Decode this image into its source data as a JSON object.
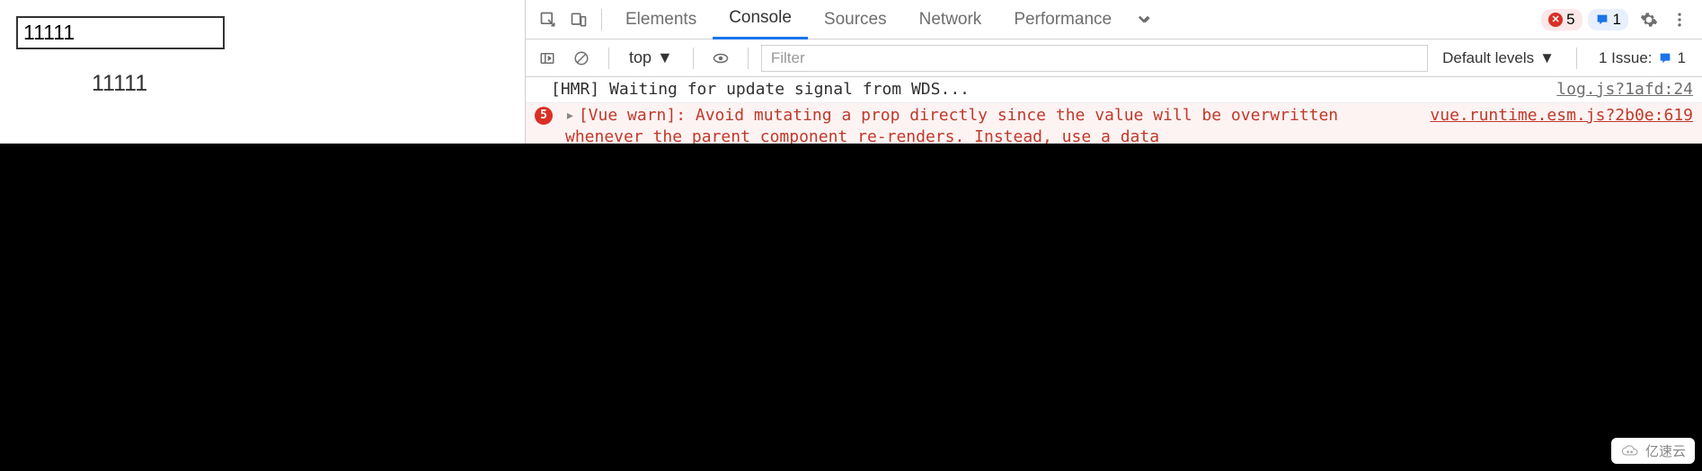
{
  "page": {
    "input_value": "11111",
    "display_value": "11111"
  },
  "devtools": {
    "tabs": {
      "elements": "Elements",
      "console": "Console",
      "sources": "Sources",
      "network": "Network",
      "performance": "Performance"
    },
    "error_count": "5",
    "info_count": "1",
    "toolbar": {
      "context": "top",
      "filter_placeholder": "Filter",
      "levels": "Default levels",
      "issues_label": "1 Issue:",
      "issues_count": "1"
    },
    "logs": {
      "hmr": {
        "msg": "[HMR] Waiting for update signal from WDS...",
        "src": "log.js?1afd:24"
      },
      "err": {
        "count": "5",
        "msg": "[Vue warn]: Avoid mutating a prop directly since the value will be overwritten whenever the parent component re-renders. Instead, use a data",
        "src": "vue.runtime.esm.js?2b0e:619"
      }
    }
  },
  "watermark": "亿速云"
}
